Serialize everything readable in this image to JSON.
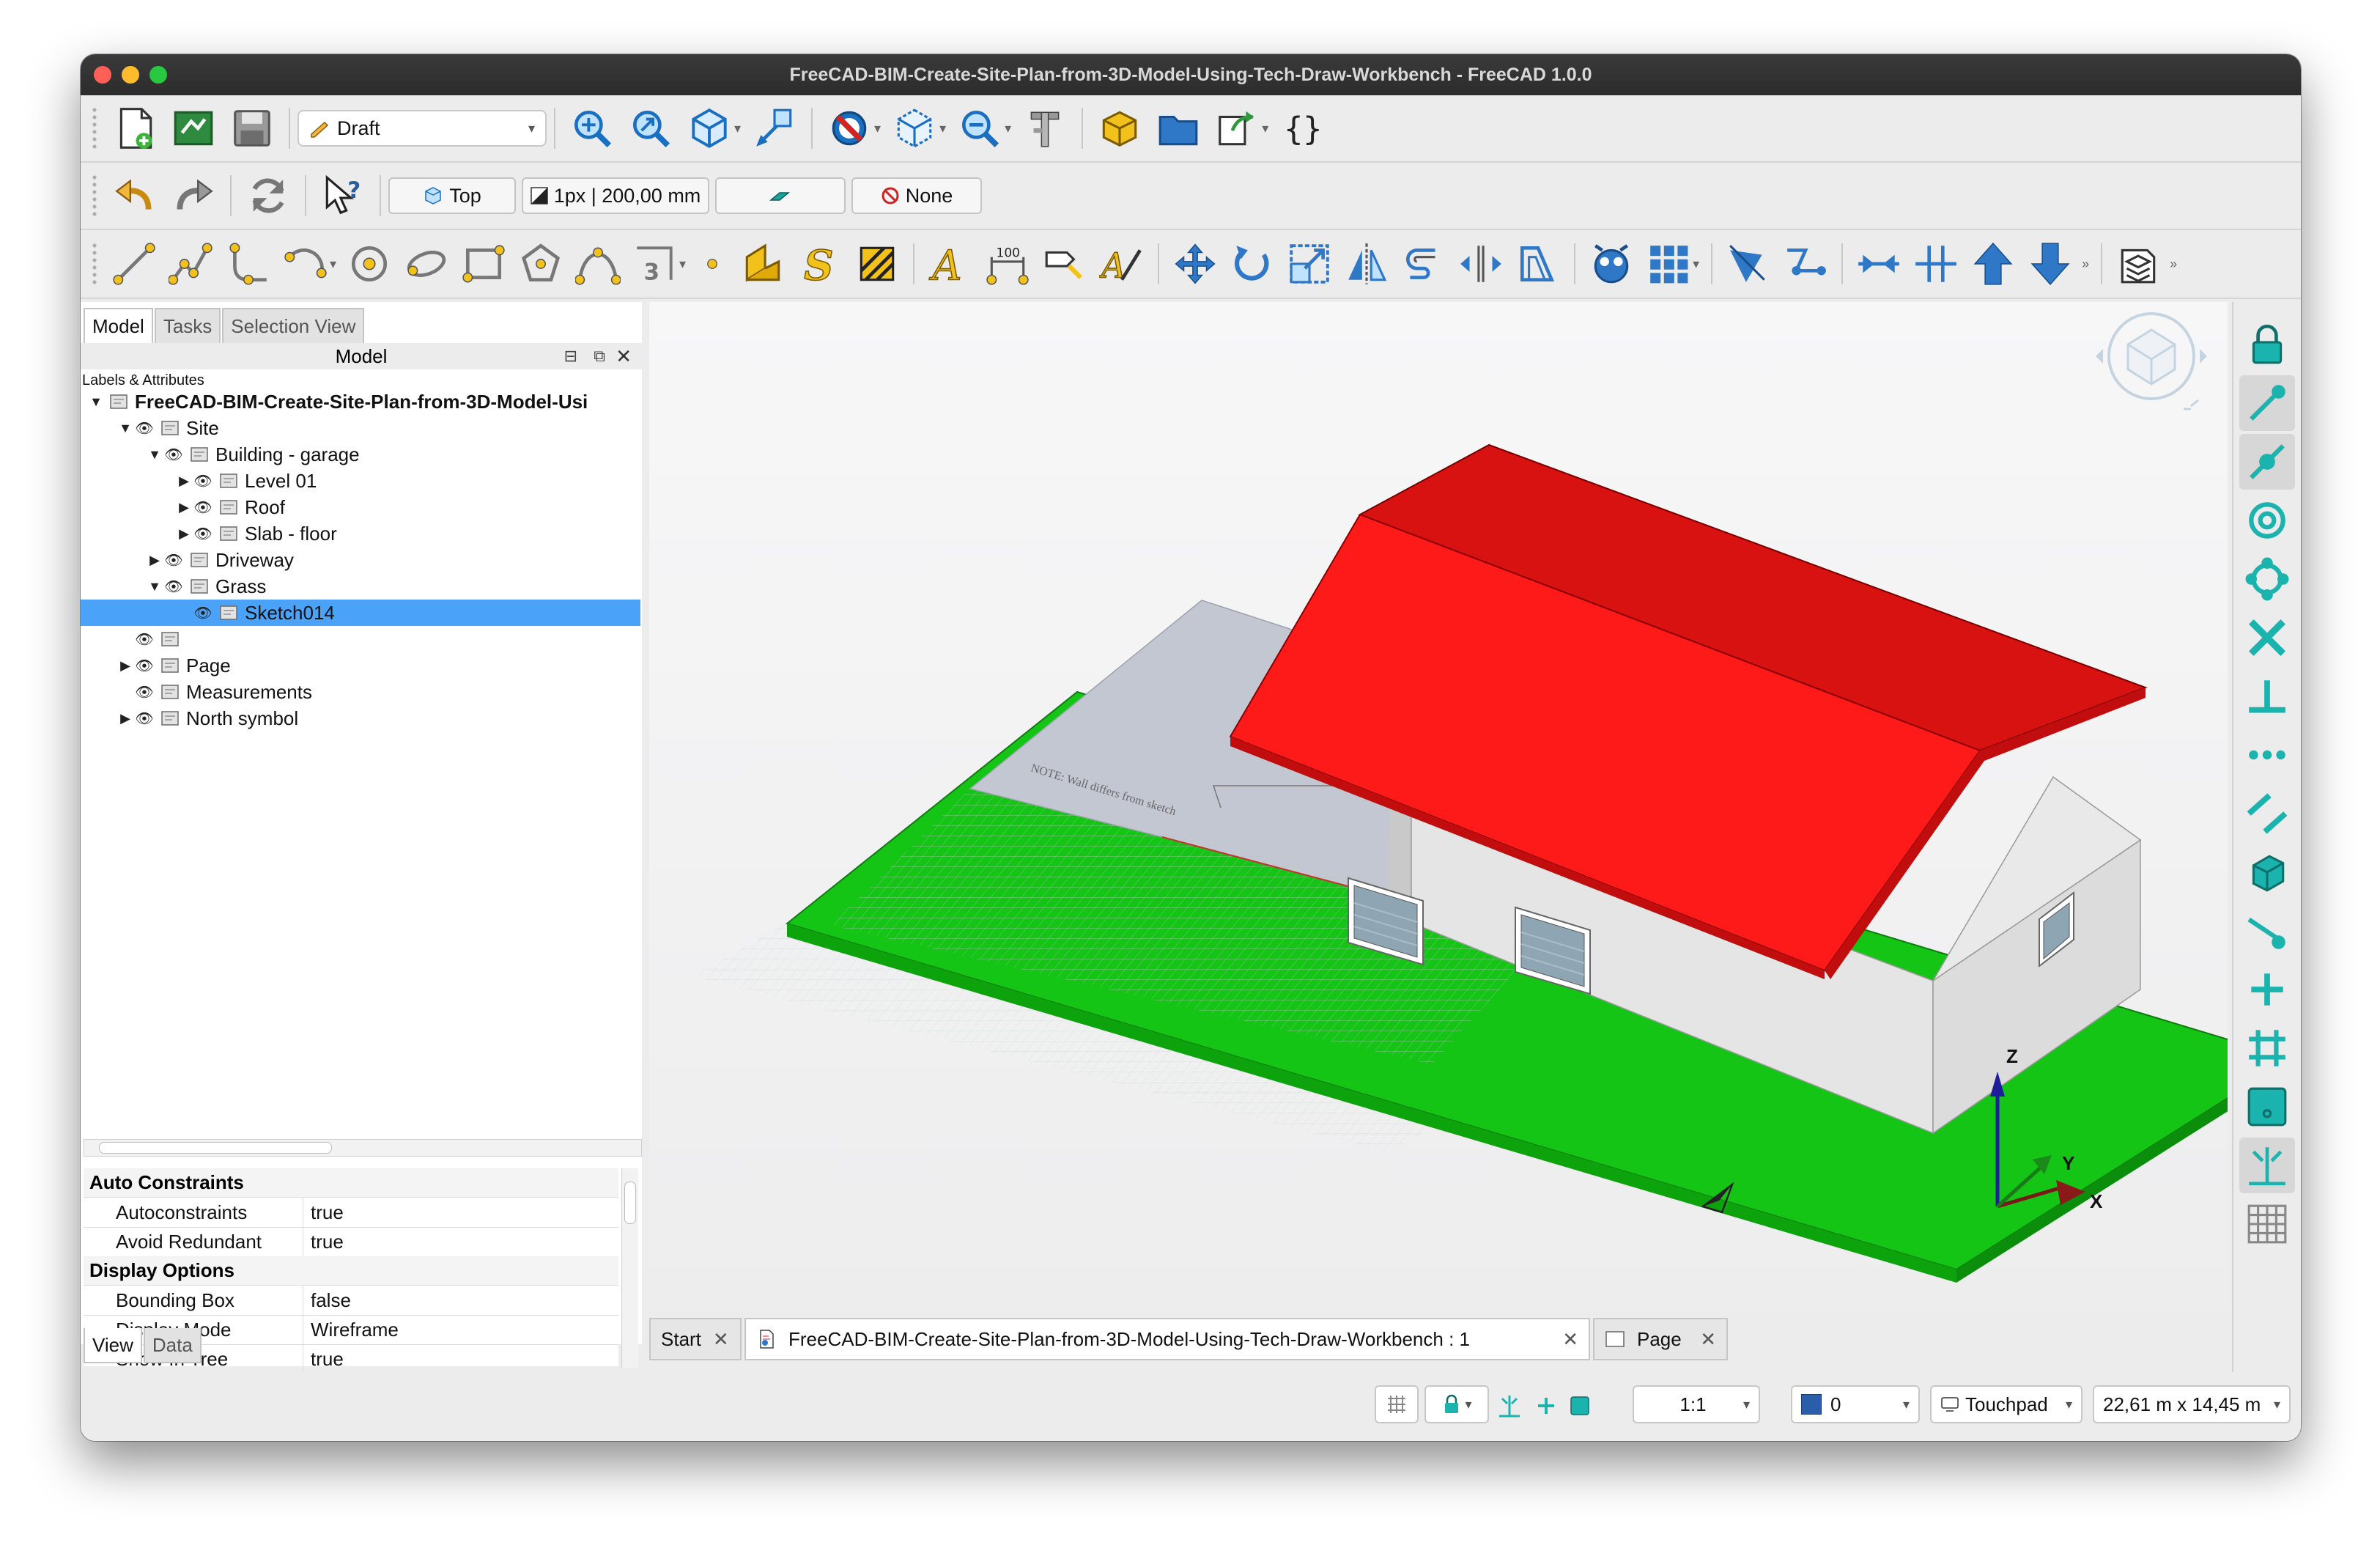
{
  "window": {
    "title": "FreeCAD-BIM-Create-Site-Plan-from-3D-Model-Using-Tech-Draw-Workbench - FreeCAD 1.0.0"
  },
  "toolbar1": {
    "workbench": "Draft",
    "icons": [
      "new-document-icon",
      "open-document-icon",
      "save-icon",
      "fit-all-icon",
      "fit-selection-icon",
      "view-cube-icon",
      "measure-icon",
      "draw-style-icon",
      "bounding-box-icon",
      "zoom-icon",
      "measure-caliper-icon",
      "part-box-icon",
      "folder-icon",
      "export-icon",
      "macro-icon"
    ]
  },
  "toolbar2": {
    "view": "Top",
    "line_width": "1px | 200,00 mm",
    "snap": "None"
  },
  "panel": {
    "tabs": [
      "Model",
      "Tasks",
      "Selection View"
    ],
    "header": "Model",
    "labels_header": "Labels & Attributes"
  },
  "tree": [
    {
      "label": "FreeCAD-BIM-Create-Site-Plan-from-3D-Model-Usi",
      "indent": 0,
      "arrow": "down",
      "eye": false,
      "bold": true
    },
    {
      "label": "Site",
      "indent": 1,
      "arrow": "down",
      "eye": true
    },
    {
      "label": "Building - garage",
      "indent": 2,
      "arrow": "down",
      "eye": true
    },
    {
      "label": "Level 01",
      "indent": 3,
      "arrow": "right",
      "eye": true
    },
    {
      "label": "Roof",
      "indent": 3,
      "arrow": "right",
      "eye": true
    },
    {
      "label": "Slab - floor",
      "indent": 3,
      "arrow": "right",
      "eye": true
    },
    {
      "label": "Driveway",
      "indent": 2,
      "arrow": "right",
      "eye": true
    },
    {
      "label": "Grass",
      "indent": 2,
      "arrow": "down",
      "eye": true
    },
    {
      "label": "Sketch014",
      "indent": 3,
      "arrow": "",
      "eye": true,
      "selected": true
    },
    {
      "label": "",
      "indent": 1,
      "arrow": "",
      "eye": true
    },
    {
      "label": "Page",
      "indent": 1,
      "arrow": "right",
      "eye": true
    },
    {
      "label": "Measurements",
      "indent": 1,
      "arrow": "",
      "eye": true
    },
    {
      "label": "North symbol",
      "indent": 1,
      "arrow": "right",
      "eye": true
    }
  ],
  "properties": {
    "groups": [
      {
        "name": "Auto Constraints",
        "rows": [
          {
            "key": "Autoconstraints",
            "value": "true"
          },
          {
            "key": "Avoid Redundant",
            "value": "true"
          }
        ]
      },
      {
        "name": "Display Options",
        "rows": [
          {
            "key": "Bounding Box",
            "value": "false"
          },
          {
            "key": "Display Mode",
            "value": "Wireframe"
          },
          {
            "key": "Show In Tree",
            "value": "true"
          }
        ]
      }
    ],
    "tabs": [
      "View",
      "Data"
    ]
  },
  "viewport": {
    "sketch_note": "NOTE: Wall differs from sketch",
    "axes": {
      "x": "X",
      "y": "Y",
      "z": "Z"
    },
    "colors": {
      "roof": "#ff1a1a",
      "grass": "#14c914",
      "wall": "#e8e8e8",
      "driveway": "#c4c8d2",
      "background": "#f2f2f3"
    }
  },
  "doc_tabs": [
    {
      "label": "Start"
    },
    {
      "label": "FreeCAD-BIM-Create-Site-Plan-from-3D-Model-Using-Tech-Draw-Workbench : 1"
    },
    {
      "label": "Page"
    }
  ],
  "status": {
    "scale": "1:1",
    "layer": "0",
    "nav": "Touchpad",
    "dims": "22,61 m x 14,45 m"
  }
}
